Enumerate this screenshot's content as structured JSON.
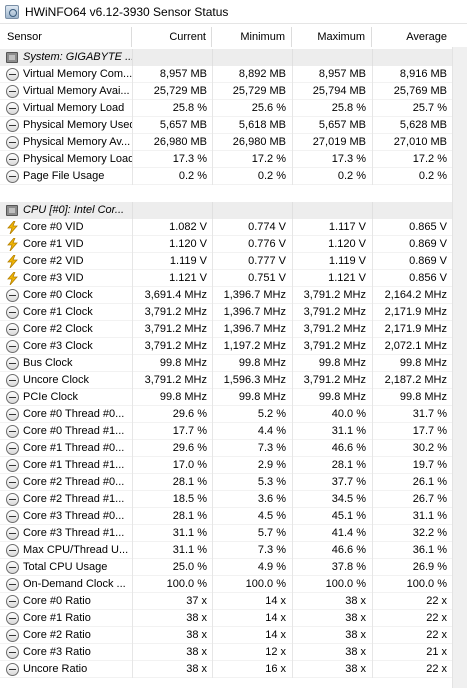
{
  "window": {
    "title": "HWiNFO64 v6.12-3930 Sensor Status"
  },
  "columns": {
    "sensor": "Sensor",
    "current": "Current",
    "minimum": "Minimum",
    "maximum": "Maximum",
    "average": "Average"
  },
  "rows": [
    {
      "kind": "group",
      "icon": "chip-icon",
      "name": "System: GIGABYTE ...",
      "current": "",
      "minimum": "",
      "maximum": "",
      "average": ""
    },
    {
      "kind": "data",
      "icon": "clock-icon",
      "name": "Virtual Memory Com...",
      "current": "8,957 MB",
      "minimum": "8,892 MB",
      "maximum": "8,957 MB",
      "average": "8,916 MB"
    },
    {
      "kind": "data",
      "icon": "clock-icon",
      "name": "Virtual Memory Avai...",
      "current": "25,729 MB",
      "minimum": "25,729 MB",
      "maximum": "25,794 MB",
      "average": "25,769 MB"
    },
    {
      "kind": "data",
      "icon": "clock-icon",
      "name": "Virtual Memory Load",
      "current": "25.8 %",
      "minimum": "25.6 %",
      "maximum": "25.8 %",
      "average": "25.7 %"
    },
    {
      "kind": "data",
      "icon": "clock-icon",
      "name": "Physical Memory Used",
      "current": "5,657 MB",
      "minimum": "5,618 MB",
      "maximum": "5,657 MB",
      "average": "5,628 MB"
    },
    {
      "kind": "data",
      "icon": "clock-icon",
      "name": "Physical Memory Av...",
      "current": "26,980 MB",
      "minimum": "26,980 MB",
      "maximum": "27,019 MB",
      "average": "27,010 MB"
    },
    {
      "kind": "data",
      "icon": "clock-icon",
      "name": "Physical Memory Load",
      "current": "17.3 %",
      "minimum": "17.2 %",
      "maximum": "17.3 %",
      "average": "17.2 %"
    },
    {
      "kind": "data",
      "icon": "clock-icon",
      "name": "Page File Usage",
      "current": "0.2 %",
      "minimum": "0.2 %",
      "maximum": "0.2 %",
      "average": "0.2 %"
    },
    {
      "kind": "blank",
      "icon": "",
      "name": "",
      "current": "",
      "minimum": "",
      "maximum": "",
      "average": ""
    },
    {
      "kind": "group",
      "icon": "chip-icon",
      "name": "CPU [#0]: Intel Cor...",
      "current": "",
      "minimum": "",
      "maximum": "",
      "average": ""
    },
    {
      "kind": "data",
      "icon": "bolt-icon",
      "name": "Core #0 VID",
      "current": "1.082 V",
      "minimum": "0.774 V",
      "maximum": "1.117 V",
      "average": "0.865 V"
    },
    {
      "kind": "data",
      "icon": "bolt-icon",
      "name": "Core #1 VID",
      "current": "1.120 V",
      "minimum": "0.776 V",
      "maximum": "1.120 V",
      "average": "0.869 V"
    },
    {
      "kind": "data",
      "icon": "bolt-icon",
      "name": "Core #2 VID",
      "current": "1.119 V",
      "minimum": "0.777 V",
      "maximum": "1.119 V",
      "average": "0.869 V"
    },
    {
      "kind": "data",
      "icon": "bolt-icon",
      "name": "Core #3 VID",
      "current": "1.121 V",
      "minimum": "0.751 V",
      "maximum": "1.121 V",
      "average": "0.856 V"
    },
    {
      "kind": "data",
      "icon": "clock-icon",
      "name": "Core #0 Clock",
      "current": "3,691.4 MHz",
      "minimum": "1,396.7 MHz",
      "maximum": "3,791.2 MHz",
      "average": "2,164.2 MHz"
    },
    {
      "kind": "data",
      "icon": "clock-icon",
      "name": "Core #1 Clock",
      "current": "3,791.2 MHz",
      "minimum": "1,396.7 MHz",
      "maximum": "3,791.2 MHz",
      "average": "2,171.9 MHz"
    },
    {
      "kind": "data",
      "icon": "clock-icon",
      "name": "Core #2 Clock",
      "current": "3,791.2 MHz",
      "minimum": "1,396.7 MHz",
      "maximum": "3,791.2 MHz",
      "average": "2,171.9 MHz"
    },
    {
      "kind": "data",
      "icon": "clock-icon",
      "name": "Core #3 Clock",
      "current": "3,791.2 MHz",
      "minimum": "1,197.2 MHz",
      "maximum": "3,791.2 MHz",
      "average": "2,072.1 MHz"
    },
    {
      "kind": "data",
      "icon": "clock-icon",
      "name": "Bus Clock",
      "current": "99.8 MHz",
      "minimum": "99.8 MHz",
      "maximum": "99.8 MHz",
      "average": "99.8 MHz"
    },
    {
      "kind": "data",
      "icon": "clock-icon",
      "name": "Uncore Clock",
      "current": "3,791.2 MHz",
      "minimum": "1,596.3 MHz",
      "maximum": "3,791.2 MHz",
      "average": "2,187.2 MHz"
    },
    {
      "kind": "data",
      "icon": "clock-icon",
      "name": "PCIe Clock",
      "current": "99.8 MHz",
      "minimum": "99.8 MHz",
      "maximum": "99.8 MHz",
      "average": "99.8 MHz"
    },
    {
      "kind": "data",
      "icon": "clock-icon",
      "name": "Core #0 Thread #0...",
      "current": "29.6 %",
      "minimum": "5.2 %",
      "maximum": "40.0 %",
      "average": "31.7 %"
    },
    {
      "kind": "data",
      "icon": "clock-icon",
      "name": "Core #0 Thread #1...",
      "current": "17.7 %",
      "minimum": "4.4 %",
      "maximum": "31.1 %",
      "average": "17.7 %"
    },
    {
      "kind": "data",
      "icon": "clock-icon",
      "name": "Core #1 Thread #0...",
      "current": "29.6 %",
      "minimum": "7.3 %",
      "maximum": "46.6 %",
      "average": "30.2 %"
    },
    {
      "kind": "data",
      "icon": "clock-icon",
      "name": "Core #1 Thread #1...",
      "current": "17.0 %",
      "minimum": "2.9 %",
      "maximum": "28.1 %",
      "average": "19.7 %"
    },
    {
      "kind": "data",
      "icon": "clock-icon",
      "name": "Core #2 Thread #0...",
      "current": "28.1 %",
      "minimum": "5.3 %",
      "maximum": "37.7 %",
      "average": "26.1 %"
    },
    {
      "kind": "data",
      "icon": "clock-icon",
      "name": "Core #2 Thread #1...",
      "current": "18.5 %",
      "minimum": "3.6 %",
      "maximum": "34.5 %",
      "average": "26.7 %"
    },
    {
      "kind": "data",
      "icon": "clock-icon",
      "name": "Core #3 Thread #0...",
      "current": "28.1 %",
      "minimum": "4.5 %",
      "maximum": "45.1 %",
      "average": "31.1 %"
    },
    {
      "kind": "data",
      "icon": "clock-icon",
      "name": "Core #3 Thread #1...",
      "current": "31.1 %",
      "minimum": "5.7 %",
      "maximum": "41.4 %",
      "average": "32.2 %"
    },
    {
      "kind": "data",
      "icon": "clock-icon",
      "name": "Max CPU/Thread U...",
      "current": "31.1 %",
      "minimum": "7.3 %",
      "maximum": "46.6 %",
      "average": "36.1 %"
    },
    {
      "kind": "data",
      "icon": "clock-icon",
      "name": "Total CPU Usage",
      "current": "25.0 %",
      "minimum": "4.9 %",
      "maximum": "37.8 %",
      "average": "26.9 %"
    },
    {
      "kind": "data",
      "icon": "clock-icon",
      "name": "On-Demand Clock ...",
      "current": "100.0 %",
      "minimum": "100.0 %",
      "maximum": "100.0 %",
      "average": "100.0 %"
    },
    {
      "kind": "data",
      "icon": "clock-icon",
      "name": "Core #0 Ratio",
      "current": "37 x",
      "minimum": "14 x",
      "maximum": "38 x",
      "average": "22 x"
    },
    {
      "kind": "data",
      "icon": "clock-icon",
      "name": "Core #1 Ratio",
      "current": "38 x",
      "minimum": "14 x",
      "maximum": "38 x",
      "average": "22 x"
    },
    {
      "kind": "data",
      "icon": "clock-icon",
      "name": "Core #2 Ratio",
      "current": "38 x",
      "minimum": "14 x",
      "maximum": "38 x",
      "average": "22 x"
    },
    {
      "kind": "data",
      "icon": "clock-icon",
      "name": "Core #3 Ratio",
      "current": "38 x",
      "minimum": "12 x",
      "maximum": "38 x",
      "average": "21 x"
    },
    {
      "kind": "data",
      "icon": "clock-icon",
      "name": "Uncore Ratio",
      "current": "38 x",
      "minimum": "16 x",
      "maximum": "38 x",
      "average": "22 x"
    }
  ]
}
